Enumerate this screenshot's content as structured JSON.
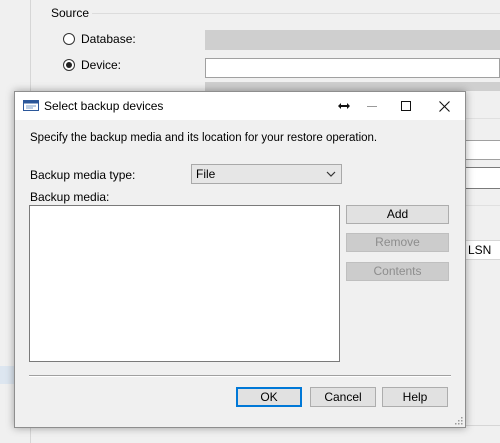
{
  "background": {
    "section_legend": "Source",
    "radio_database": "Database:",
    "radio_device": "Device:",
    "column_lsn": "LSN"
  },
  "dialog": {
    "title": "Select backup devices",
    "description": "Specify the backup media and its location for your restore operation.",
    "media_type_label": "Backup media type:",
    "media_type_value": "File",
    "media_label": "Backup media:",
    "buttons": {
      "add": "Add",
      "remove": "Remove",
      "contents": "Contents",
      "ok": "OK",
      "cancel": "Cancel",
      "help": "Help"
    }
  },
  "colors": {
    "accent": "#0078d7",
    "disabled_fill": "#cccccc",
    "disabled_text": "#8d8d8d"
  },
  "icons": [
    "app-window-icon",
    "resize-arrows-icon",
    "minimize-icon",
    "maximize-icon",
    "close-icon",
    "chevron-down-icon",
    "resize-grip-icon"
  ]
}
